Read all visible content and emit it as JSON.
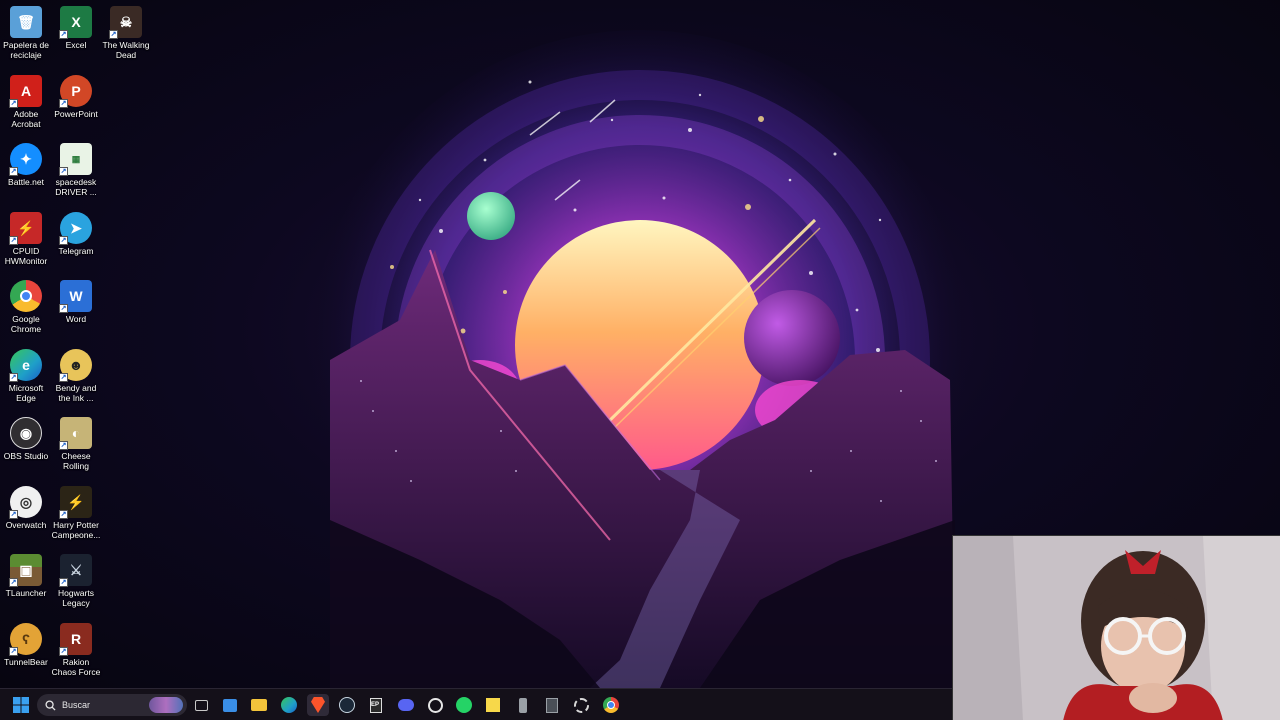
{
  "desktop": {
    "icons": [
      {
        "label": "Papelera de reciclaje",
        "icon": "recycle-bin-icon",
        "color": "#5aa0d8"
      },
      {
        "label": "Excel",
        "icon": "excel-icon",
        "color": "#1d7a44"
      },
      {
        "label": "The Walking Dead",
        "icon": "walking-dead-icon",
        "color": "#3a2a25"
      },
      {
        "label": "Adobe Acrobat",
        "icon": "acrobat-icon",
        "color": "#d0201a"
      },
      {
        "label": "PowerPoint",
        "icon": "powerpoint-icon",
        "color": "#d24726"
      },
      {
        "label": "Battle.net",
        "icon": "battlenet-icon",
        "color": "#148eff"
      },
      {
        "label": "spacedesk DRIVER ...",
        "icon": "spacedesk-icon",
        "color": "#e9f3e6"
      },
      {
        "label": "CPUID HWMonitor",
        "icon": "hwmonitor-icon",
        "color": "#c62828"
      },
      {
        "label": "Telegram",
        "icon": "telegram-icon",
        "color": "#2aa3df"
      },
      {
        "label": "Google Chrome",
        "icon": "chrome-icon",
        "color": "#e8453c"
      },
      {
        "label": "Word",
        "icon": "word-icon",
        "color": "#2b6fd6"
      },
      {
        "label": "Microsoft Edge",
        "icon": "edge-icon",
        "color": "#1fa0c8"
      },
      {
        "label": "Bendy and the Ink ...",
        "icon": "bendy-icon",
        "color": "#e8c45a"
      },
      {
        "label": "OBS Studio",
        "icon": "obs-icon",
        "color": "#302e31"
      },
      {
        "label": "Cheese Rolling",
        "icon": "cheese-rolling-icon",
        "color": "#c6b477"
      },
      {
        "label": "Overwatch",
        "icon": "overwatch-icon",
        "color": "#f0f0f0"
      },
      {
        "label": "Harry Potter Campeone...",
        "icon": "harry-potter-icon",
        "color": "#2b2416"
      },
      {
        "label": "TLauncher",
        "icon": "tlauncher-icon",
        "color": "#5b8c32"
      },
      {
        "label": "Hogwarts Legacy",
        "icon": "hogwarts-legacy-icon",
        "color": "#1b2230"
      },
      {
        "label": "TunnelBear",
        "icon": "tunnelbear-icon",
        "color": "#e3a336"
      },
      {
        "label": "Rakion Chaos Force",
        "icon": "rakion-icon",
        "color": "#8a2b1f"
      }
    ]
  },
  "taskbar": {
    "search_placeholder": "Buscar",
    "start_icon": "windows-start-icon",
    "pinned": [
      {
        "name": "task-view",
        "icon": "task-view-icon",
        "color": "#9aa0a6"
      },
      {
        "name": "microsoft-store",
        "icon": "store-icon",
        "color": "#3a8ee6"
      },
      {
        "name": "file-explorer",
        "icon": "folder-icon",
        "color": "#f3c43b"
      },
      {
        "name": "edge",
        "icon": "edge-icon",
        "color": "#1fa0c8"
      },
      {
        "name": "brave",
        "icon": "brave-icon",
        "color": "#fb542b"
      },
      {
        "name": "steam",
        "icon": "steam-icon",
        "color": "#1b2838"
      },
      {
        "name": "epic-games",
        "icon": "epic-games-icon",
        "color": "#2a2a2a"
      },
      {
        "name": "discord",
        "icon": "discord-icon",
        "color": "#5865f2"
      },
      {
        "name": "chatgpt",
        "icon": "chatgpt-icon",
        "color": "#2b2b2b"
      },
      {
        "name": "whatsapp",
        "icon": "whatsapp-icon",
        "color": "#25d366"
      },
      {
        "name": "sticky-notes",
        "icon": "sticky-notes-icon",
        "color": "#f7d84a"
      },
      {
        "name": "usb-device",
        "icon": "usb-icon",
        "color": "#9aa0a6"
      },
      {
        "name": "calculator",
        "icon": "calculator-icon",
        "color": "#4a4f57"
      },
      {
        "name": "snipping-tool",
        "icon": "snipping-tool-icon",
        "color": "#c23b3b"
      },
      {
        "name": "chrome",
        "icon": "chrome-icon",
        "color": "#e8453c"
      }
    ]
  },
  "webcam": {
    "icon": "webcam-overlay-icon"
  }
}
